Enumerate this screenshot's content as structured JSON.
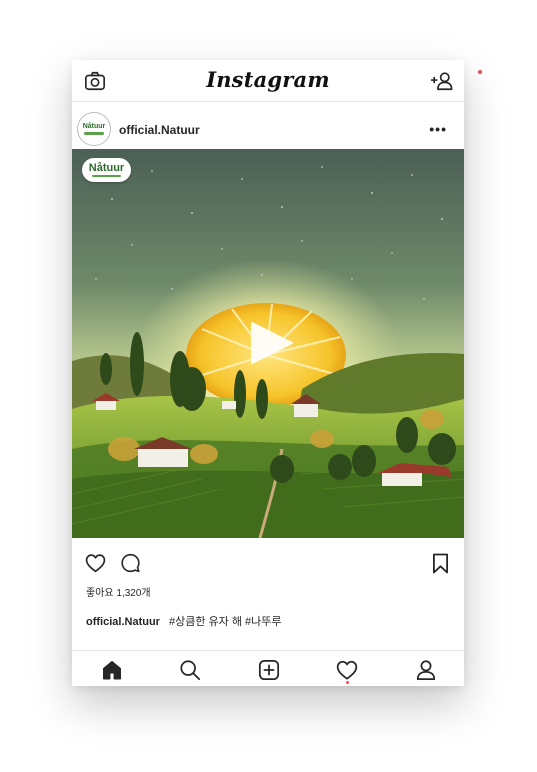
{
  "app": {
    "name": "Instagram"
  },
  "post": {
    "username": "official.Natuur",
    "avatar_text": "Nåtuur",
    "brand_badge_text": "Nåtuur",
    "likes_text": "좋아요 1,320개",
    "caption_user": "official.Natuur",
    "caption_text": "#상큼한 유자 해 #나뚜루",
    "more_label": "•••"
  },
  "icons": {
    "top_left": "camera-icon",
    "top_right": "add-user-icon",
    "play": "play-icon",
    "like": "heart-icon",
    "comment": "comment-icon",
    "save": "bookmark-icon",
    "tabs": [
      "home-icon",
      "search-icon",
      "add-post-icon",
      "activity-heart-icon",
      "profile-icon"
    ]
  },
  "colors": {
    "accent_red": "#ed4956",
    "brand_green": "#2e6a2e",
    "sky_top": "#4b5f55",
    "sun_yellow": "#f6c42a"
  }
}
